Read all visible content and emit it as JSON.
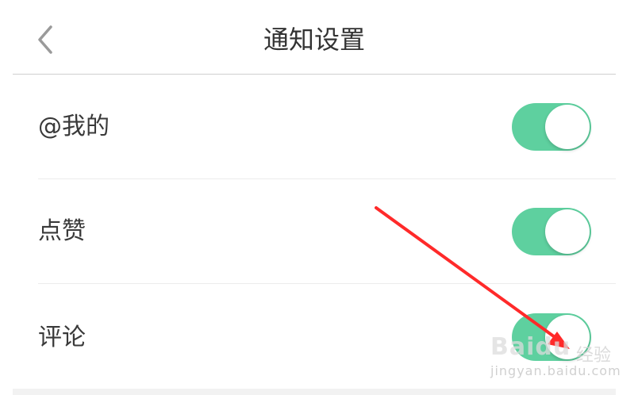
{
  "header": {
    "title": "通知设置",
    "back_icon": "chevron-left-icon"
  },
  "settings": [
    {
      "label": "@我的",
      "enabled": true
    },
    {
      "label": "点赞",
      "enabled": true
    },
    {
      "label": "评论",
      "enabled": true
    }
  ],
  "colors": {
    "toggle_on": "#5ed09f",
    "annotation_arrow": "#ff2a2a"
  },
  "watermark": {
    "brand": "Baidu",
    "sub": "经验",
    "url": "jingyan.baidu.com"
  }
}
